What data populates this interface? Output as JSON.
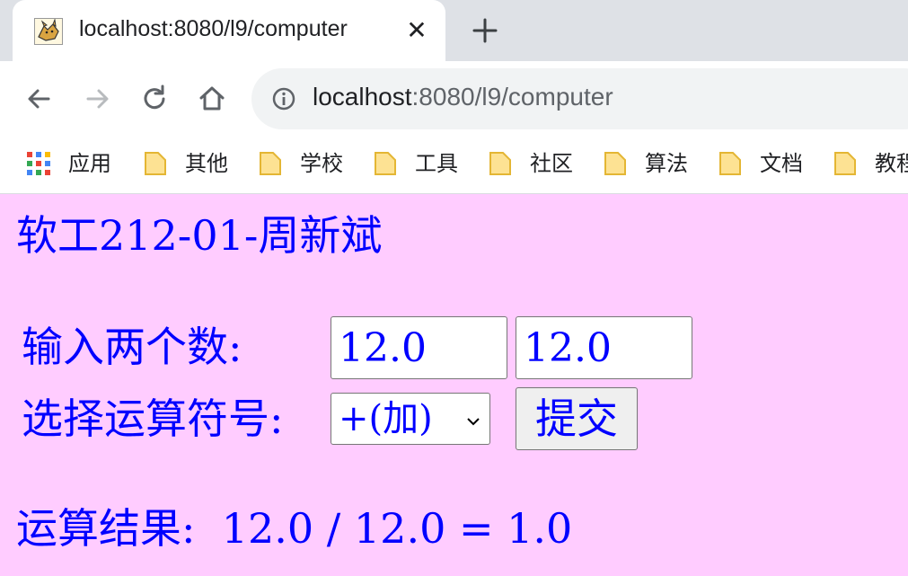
{
  "browser": {
    "tab": {
      "title": "localhost:8080/l9/computer",
      "close_glyph": "✕",
      "favicon": "tomcat-icon"
    },
    "new_tab_glyph": "+",
    "toolbar": {
      "back_icon": "back-arrow-icon",
      "forward_icon": "forward-arrow-icon",
      "reload_icon": "reload-icon",
      "home_icon": "home-icon",
      "url_host": "localhost",
      "url_rest": ":8080/l9/computer"
    },
    "bookmarks": [
      {
        "label": "应用",
        "icon": "apps-grid-icon"
      },
      {
        "label": "其他",
        "icon": "folder-icon"
      },
      {
        "label": "学校",
        "icon": "folder-icon"
      },
      {
        "label": "工具",
        "icon": "folder-icon"
      },
      {
        "label": "社区",
        "icon": "folder-icon"
      },
      {
        "label": "算法",
        "icon": "folder-icon"
      },
      {
        "label": "文档",
        "icon": "folder-icon"
      },
      {
        "label": "教程",
        "icon": "folder-icon"
      }
    ]
  },
  "page": {
    "background": "#ffccff",
    "text_color": "#0000ff",
    "heading": "软工212-01-周新斌",
    "input_label": "输入两个数:",
    "num1_value": "12.0",
    "num2_value": "12.0",
    "operator_label": "选择运算符号:",
    "operator_selected": "+(加)",
    "submit_label": "提交",
    "result_label": "运算结果:",
    "result_expression": "12.0 / 12.0 = 1.0"
  }
}
